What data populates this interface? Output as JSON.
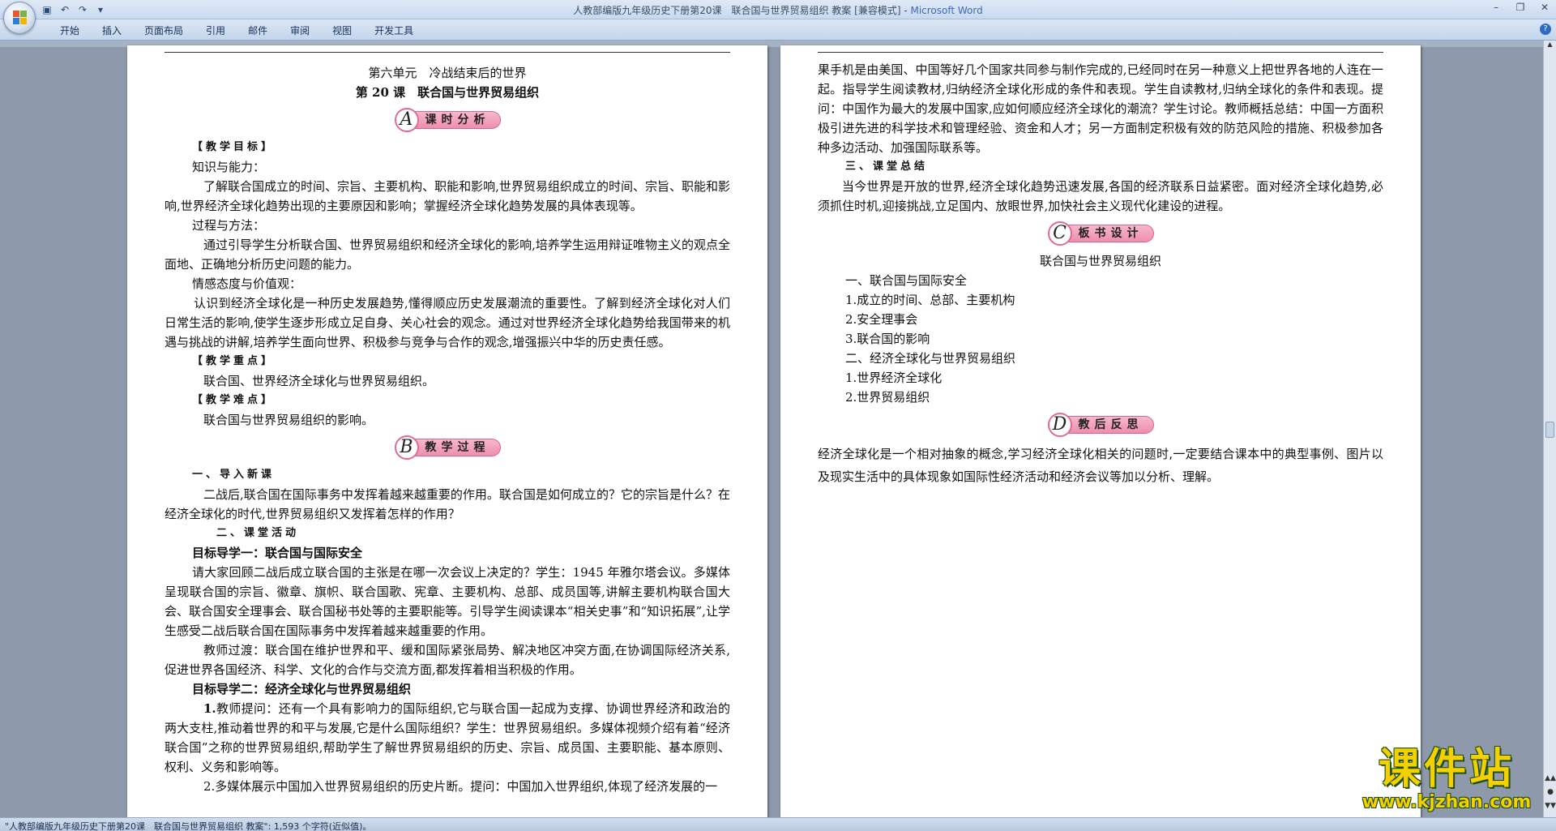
{
  "window": {
    "title_doc": "人教部编版九年级历史下册第20课　联合国与世界贸易组织  教案 [兼容模式] - ",
    "title_app": "Microsoft Word",
    "qat": [
      "save-icon",
      "undo-icon",
      "redo-icon",
      "customize-icon"
    ],
    "ctrls": {
      "minimize": "–",
      "restore": "❐",
      "close": "✕"
    }
  },
  "ribbon": {
    "tabs": [
      "开始",
      "插入",
      "页面布局",
      "引用",
      "邮件",
      "审阅",
      "视图",
      "开发工具"
    ],
    "help": "?"
  },
  "page1": {
    "unit": "第六单元　冷战结束后的世界",
    "lesson": "第 20 课　联合国与世界贸易组织",
    "badgeA": {
      "letter": "A",
      "text": "课时分析"
    },
    "goals_title": "【教学目标】",
    "k_title": "知识与能力：",
    "k_text": "了解联合国成立的时间、宗旨、主要机构、职能和影响,世界贸易组织成立的时间、宗旨、职能和影响,世界经济全球化趋势出现的主要原因和影响；掌握经济全球化趋势发展的具体表现等。",
    "p_title": "过程与方法：",
    "p_text": "通过引导学生分析联合国、世界贸易组织和经济全球化的影响,培养学生运用辩证唯物主义的观点全面地、正确地分析历史问题的能力。",
    "e_title": "情感态度与价值观：",
    "e_text": "认识到经济全球化是一种历史发展趋势,懂得顺应历史发展潮流的重要性。了解到经济全球化对人们日常生活的影响,使学生逐步形成立足自身、关心社会的观念。通过对世界经济全球化趋势给我国带来的机遇与挑战的讲解,培养学生面向世界、积极参与竞争与合作的观念,增强振兴中华的历史责任感。",
    "key_title": "【教学重点】",
    "key_text": "联合国、世界经济全球化与世界贸易组织。",
    "diff_title": "【教学难点】",
    "diff_text": "联合国与世界贸易组织的影响。",
    "badgeB": {
      "letter": "B",
      "text": "教学过程"
    },
    "s1_title": "一、导入新课",
    "s1_text": "二战后,联合国在国际事务中发挥着越来越重要的作用。联合国是如何成立的？它的宗旨是什么？在经济全球化的时代,世界贸易组织又发挥着怎样的作用？",
    "s2_title": "二、课堂活动",
    "g1_title": "目标导学一：联合国与国际安全",
    "g1_text": "请大家回顾二战后成立联合国的主张是在哪一次会议上决定的？学生：1945 年雅尔塔会议。多媒体呈现联合国的宗旨、徽章、旗帜、联合国歌、宪章、主要机构、总部、成员国等,讲解主要机构联合国大会、联合国安全理事会、联合国秘书处等的主要职能等。引导学生阅读课本“相关史事”和“知识拓展”,让学生感受二战后联合国在国际事务中发挥着越来越重要的作用。",
    "trans_text": "教师过渡：联合国在维护世界和平、缓和国际紧张局势、解决地区冲突方面,在协调国际经济关系,促进世界各国经济、科学、文化的合作与交流方面,都发挥着相当积极的作用。",
    "g2_title": "目标导学二：经济全球化与世界贸易组织",
    "q1_num": "1.",
    "q1_text": "教师提问：还有一个具有影响力的国际组织,它与联合国一起成为支撑、协调世界经济和政治的两大支柱,推动着世界的和平与发展,它是什么国际组织？学生：世界贸易组织。多媒体视频介绍有着“经济联合国”之称的世界贸易组织,帮助学生了解世界贸易组织的历史、宗旨、成员国、主要职能、基本原则、权利、义务和影响等。",
    "q2_text": "2.多媒体展示中国加入世界贸易组织的历史片断。提问：中国加入世界组织,体现了经济发展的一"
  },
  "page2": {
    "cont_text": "果手机是由美国、中国等好几个国家共同参与制作完成的,已经同时在另一种意义上把世界各地的人连在一起。指导学生阅读教材,归纳经济全球化形成的条件和表现。学生自读教材,归纳全球化的条件和表现。提问：中国作为最大的发展中国家,应如何顺应经济全球化的潮流？学生讨论。教师概括总结：中国一方面积极引进先进的科学技术和管理经验、资金和人才；另一方面制定积极有效的防范风险的措施、积极参加各种多边活动、加强国际联系等。",
    "s3_title": "三、课堂总结",
    "s3_text": "当今世界是开放的世界,经济全球化趋势迅速发展,各国的经济联系日益紧密。面对经济全球化趋势,必须抓住时机,迎接挑战,立足国内、放眼世界,加快社会主义现代化建设的进程。",
    "badgeC": {
      "letter": "C",
      "text": "板书设计"
    },
    "board_title": "联合国与世界贸易组织",
    "board": [
      "一、联合国与国际安全",
      "1.成立的时间、总部、主要机构",
      "2.安全理事会",
      "3.联合国的影响",
      "二、经济全球化与世界贸易组织",
      "1.世界经济全球化",
      "2.世界贸易组织"
    ],
    "badgeD": {
      "letter": "D",
      "text": "教后反思"
    },
    "reflect": "经济全球化是一个相对抽象的概念,学习经济全球化相关的问题时,一定要结合课本中的典型事例、图片以及现实生活中的具体现象如国际性经济活动和经济会议等加以分析、理解。"
  },
  "status": {
    "text": "\"人教部编版九年级历史下册第20课　联合国与世界贸易组织  教案\": 1,593 个字符(近似值)。"
  },
  "watermark": {
    "cn": "课件站",
    "url": "www.kjzhan.com"
  },
  "colors": {
    "accent": "#2d6cc0",
    "badge_pink": "#ee8db0",
    "watermark_yellow": "#f4d000"
  }
}
